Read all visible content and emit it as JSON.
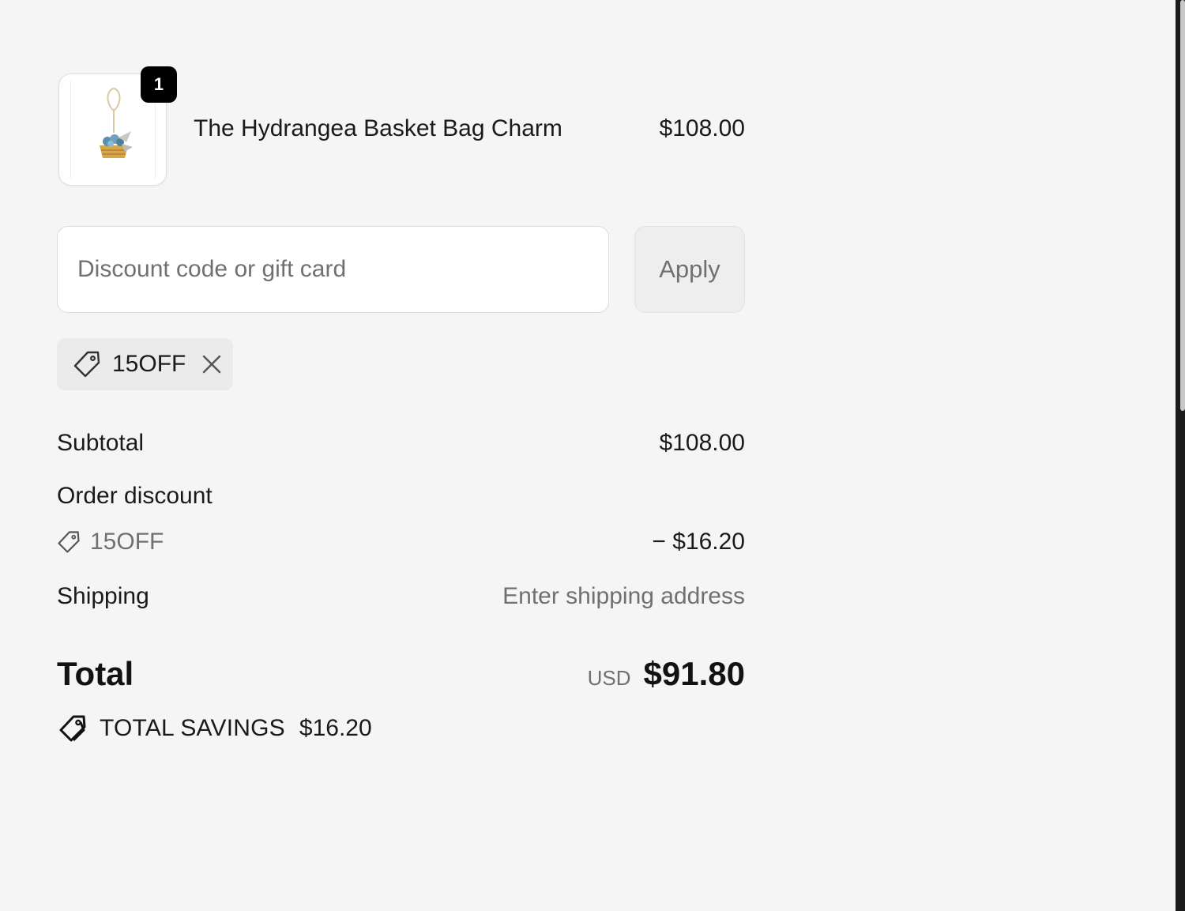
{
  "line_item": {
    "quantity": "1",
    "name": "The Hydrangea Basket Bag Charm",
    "price": "$108.00",
    "image_icon": "bag-charm-product-thumbnail"
  },
  "discount_form": {
    "placeholder": "Discount code or gift card",
    "value": "",
    "apply_label": "Apply"
  },
  "applied_code": {
    "code": "15OFF",
    "tag_icon": "tag-icon",
    "remove_icon": "close-icon"
  },
  "totals": {
    "subtotal_label": "Subtotal",
    "subtotal_value": "$108.00",
    "order_discount_label": "Order discount",
    "discount_code": "15OFF",
    "discount_value": "− $16.20",
    "shipping_label": "Shipping",
    "shipping_value": "Enter shipping address",
    "total_label": "Total",
    "currency": "USD",
    "total_value": "$91.80",
    "savings_label": "TOTAL SAVINGS",
    "savings_value": "$16.20"
  },
  "colors": {
    "background": "#f5f5f5",
    "text_primary": "#121212",
    "text_muted": "#707070",
    "badge": "#000000",
    "chip": "#ebebeb"
  }
}
